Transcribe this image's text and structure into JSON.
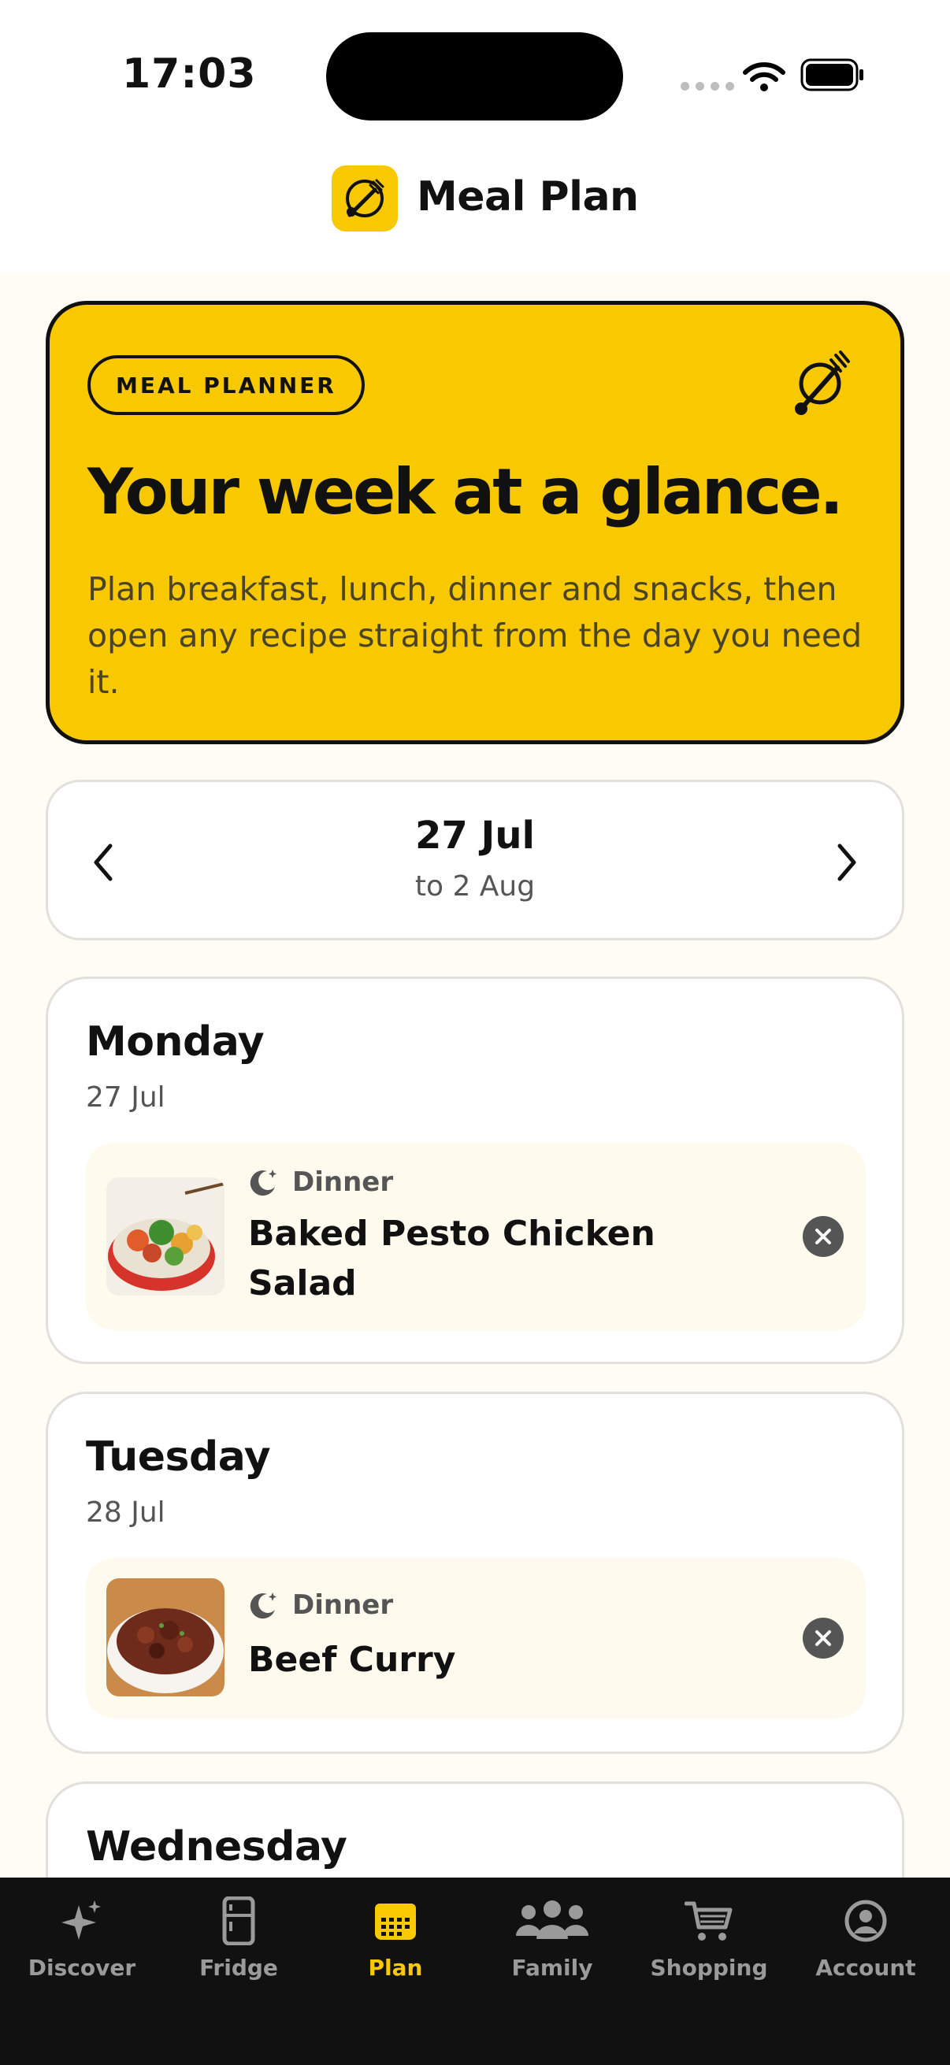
{
  "status_bar": {
    "time": "17:03"
  },
  "header": {
    "title": "Meal Plan"
  },
  "hero": {
    "badge": "MEAL PLANNER",
    "title": "Your week at a glance.",
    "description": "Plan breakfast, lunch, dinner and snacks, then open any recipe straight from the day you need it."
  },
  "week": {
    "start": "27 Jul",
    "end": "to 2 Aug"
  },
  "days": [
    {
      "name": "Monday",
      "date": "27 Jul",
      "meals": [
        {
          "type": "Dinner",
          "name": "Baked Pesto Chicken Salad",
          "icon": "moon-icon"
        }
      ]
    },
    {
      "name": "Tuesday",
      "date": "28 Jul",
      "meals": [
        {
          "type": "Dinner",
          "name": "Beef Curry",
          "icon": "moon-icon"
        }
      ]
    },
    {
      "name": "Wednesday"
    }
  ],
  "tabs": [
    {
      "label": "Discover",
      "icon": "sparkle-icon"
    },
    {
      "label": "Fridge",
      "icon": "fridge-icon"
    },
    {
      "label": "Plan",
      "icon": "calendar-icon",
      "active": true
    },
    {
      "label": "Family",
      "icon": "people-icon"
    },
    {
      "label": "Shopping",
      "icon": "cart-icon"
    },
    {
      "label": "Account",
      "icon": "account-icon"
    }
  ],
  "colors": {
    "accent": "#F8C800",
    "background": "#FFFCF5",
    "dark": "#111111"
  }
}
